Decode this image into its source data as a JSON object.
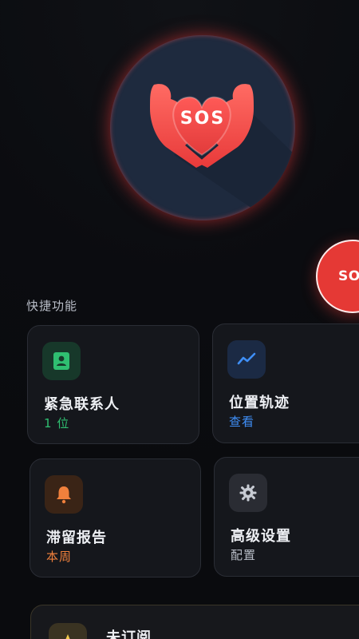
{
  "hero": {
    "logo_text": "SOS",
    "logo_icon": "heart-hands-icon",
    "glow_color": "#ff3c3c",
    "bg_color": "#1e2a3e"
  },
  "fab": {
    "label": "SOS",
    "color": "#e53935"
  },
  "quick_actions": {
    "title": "快捷功能",
    "cards": [
      {
        "title": "紧急联系人",
        "subtitle": "1 位",
        "icon": "contact-card-icon",
        "accent": "#2fbf71"
      },
      {
        "title": "位置轨迹",
        "subtitle": "查看",
        "icon": "trend-line-icon",
        "accent": "#3f8ff7"
      },
      {
        "title": "滞留报告",
        "subtitle": "本周",
        "icon": "bell-icon",
        "accent": "#f0803c"
      },
      {
        "title": "高级设置",
        "subtitle": "配置",
        "icon": "gear-icon",
        "accent": "#b7bcc6"
      }
    ]
  },
  "subscription": {
    "title": "未订阅",
    "icon": "star-icon",
    "accent": "#f2c94c"
  }
}
